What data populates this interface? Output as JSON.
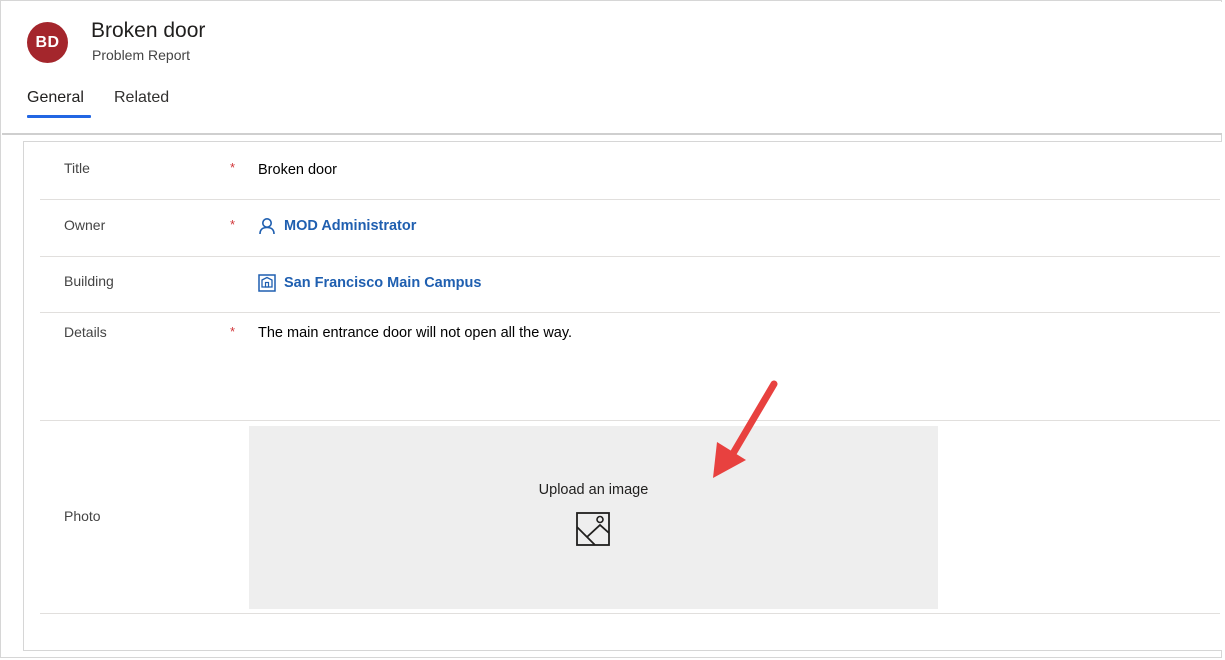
{
  "header": {
    "avatar_initials": "BD",
    "avatar_color": "#a4262c",
    "record_title": "Broken door",
    "record_type": "Problem Report"
  },
  "tabs": [
    {
      "label": "General",
      "selected": true
    },
    {
      "label": "Related",
      "selected": false
    }
  ],
  "accent_color": "#2266e3",
  "form": {
    "title": {
      "label": "Title",
      "required": "*",
      "value": "Broken door"
    },
    "owner": {
      "label": "Owner",
      "required": "*",
      "value": "MOD Administrator",
      "icon": "person-icon"
    },
    "building": {
      "label": "Building",
      "value": "San Francisco Main Campus",
      "icon": "building-icon"
    },
    "details": {
      "label": "Details",
      "required": "*",
      "value": "The main entrance door will not open all the way."
    },
    "photo": {
      "label": "Photo",
      "upload_text": "Upload an image",
      "icon": "image-placeholder-icon"
    }
  },
  "annotation": {
    "type": "red-arrow-icon",
    "color": "#e8413f"
  }
}
